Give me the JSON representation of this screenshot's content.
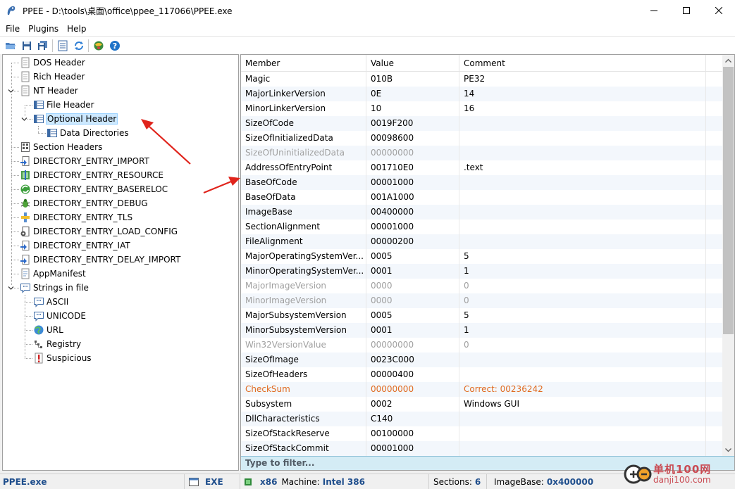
{
  "window": {
    "title": "PPEE - D:\\tools\\桌面\\office\\ppee_117066\\PPEE.exe"
  },
  "menu": [
    "File",
    "Plugins",
    "Help"
  ],
  "toolbar": [
    "open-icon",
    "save-icon",
    "save-all-icon",
    "properties-icon",
    "refresh-icon",
    "plugins-icon",
    "help-icon"
  ],
  "tree": [
    {
      "label": "DOS Header",
      "icon": "doc-icon",
      "level": 0,
      "selected": false
    },
    {
      "label": "Rich Header",
      "icon": "doc-icon",
      "level": 0,
      "selected": false
    },
    {
      "label": "NT Header",
      "icon": "doc-icon",
      "level": 0,
      "selected": false
    },
    {
      "label": "File Header",
      "icon": "grid-icon",
      "level": 1,
      "selected": false
    },
    {
      "label": "Optional Header",
      "icon": "grid-icon",
      "level": 1,
      "selected": true
    },
    {
      "label": "Data Directories",
      "icon": "grid-icon",
      "level": 2,
      "selected": false
    },
    {
      "label": "Section Headers",
      "icon": "sections-icon",
      "level": 0,
      "selected": false
    },
    {
      "label": "DIRECTORY_ENTRY_IMPORT",
      "icon": "import-icon",
      "level": 0,
      "selected": false
    },
    {
      "label": "DIRECTORY_ENTRY_RESOURCE",
      "icon": "resource-icon",
      "level": 0,
      "selected": false
    },
    {
      "label": "DIRECTORY_ENTRY_BASERELOC",
      "icon": "reloc-icon",
      "level": 0,
      "selected": false
    },
    {
      "label": "DIRECTORY_ENTRY_DEBUG",
      "icon": "bug-icon",
      "level": 0,
      "selected": false
    },
    {
      "label": "DIRECTORY_ENTRY_TLS",
      "icon": "tls-icon",
      "level": 0,
      "selected": false
    },
    {
      "label": "DIRECTORY_ENTRY_LOAD_CONFIG",
      "icon": "config-icon",
      "level": 0,
      "selected": false
    },
    {
      "label": "DIRECTORY_ENTRY_IAT",
      "icon": "import-icon",
      "level": 0,
      "selected": false
    },
    {
      "label": "DIRECTORY_ENTRY_DELAY_IMPORT",
      "icon": "import-icon",
      "level": 0,
      "selected": false
    },
    {
      "label": "AppManifest",
      "icon": "manifest-icon",
      "level": 0,
      "selected": false
    },
    {
      "label": "Strings in file",
      "icon": "strings-icon",
      "level": 0,
      "selected": false
    },
    {
      "label": "ASCII",
      "icon": "strings-icon",
      "level": 1,
      "selected": false
    },
    {
      "label": "UNICODE",
      "icon": "strings-icon",
      "level": 1,
      "selected": false
    },
    {
      "label": "URL",
      "icon": "globe-icon",
      "level": 1,
      "selected": false
    },
    {
      "label": "Registry",
      "icon": "registry-icon",
      "level": 1,
      "selected": false
    },
    {
      "label": "Suspicious",
      "icon": "warning-icon",
      "level": 1,
      "selected": false
    }
  ],
  "grid": {
    "columns": [
      "Member",
      "Value",
      "Comment"
    ],
    "rows": [
      {
        "member": "Magic",
        "value": "010B",
        "comment": "PE32",
        "state": "normal"
      },
      {
        "member": "MajorLinkerVersion",
        "value": "0E",
        "comment": "14",
        "state": "normal"
      },
      {
        "member": "MinorLinkerVersion",
        "value": "10",
        "comment": "16",
        "state": "normal"
      },
      {
        "member": "SizeOfCode",
        "value": "0019F200",
        "comment": "",
        "state": "normal"
      },
      {
        "member": "SizeOfInitializedData",
        "value": "00098600",
        "comment": "",
        "state": "normal"
      },
      {
        "member": "SizeOfUninitializedData",
        "value": "00000000",
        "comment": "",
        "state": "dim"
      },
      {
        "member": "AddressOfEntryPoint",
        "value": "001710E0",
        "comment": ".text",
        "state": "normal"
      },
      {
        "member": "BaseOfCode",
        "value": "00001000",
        "comment": "",
        "state": "normal"
      },
      {
        "member": "BaseOfData",
        "value": "001A1000",
        "comment": "",
        "state": "normal"
      },
      {
        "member": "ImageBase",
        "value": "00400000",
        "comment": "",
        "state": "normal"
      },
      {
        "member": "SectionAlignment",
        "value": "00001000",
        "comment": "",
        "state": "normal"
      },
      {
        "member": "FileAlignment",
        "value": "00000200",
        "comment": "",
        "state": "normal"
      },
      {
        "member": "MajorOperatingSystemVer...",
        "value": "0005",
        "comment": "5",
        "state": "normal"
      },
      {
        "member": "MinorOperatingSystemVer...",
        "value": "0001",
        "comment": "1",
        "state": "normal"
      },
      {
        "member": "MajorImageVersion",
        "value": "0000",
        "comment": "0",
        "state": "dim"
      },
      {
        "member": "MinorImageVersion",
        "value": "0000",
        "comment": "0",
        "state": "dim"
      },
      {
        "member": "MajorSubsystemVersion",
        "value": "0005",
        "comment": "5",
        "state": "normal"
      },
      {
        "member": "MinorSubsystemVersion",
        "value": "0001",
        "comment": "1",
        "state": "normal"
      },
      {
        "member": "Win32VersionValue",
        "value": "00000000",
        "comment": "0",
        "state": "dim"
      },
      {
        "member": "SizeOfImage",
        "value": "0023C000",
        "comment": "",
        "state": "normal"
      },
      {
        "member": "SizeOfHeaders",
        "value": "00000400",
        "comment": "",
        "state": "normal"
      },
      {
        "member": "CheckSum",
        "value": "00000000",
        "comment": "Correct: 00236242",
        "state": "warn"
      },
      {
        "member": "Subsystem",
        "value": "0002",
        "comment": "Windows GUI",
        "state": "normal"
      },
      {
        "member": "DllCharacteristics",
        "value": "C140",
        "comment": "",
        "state": "normal"
      },
      {
        "member": "SizeOfStackReserve",
        "value": "00100000",
        "comment": "",
        "state": "normal"
      },
      {
        "member": "SizeOfStackCommit",
        "value": "00001000",
        "comment": "",
        "state": "normal"
      }
    ],
    "filter_placeholder": "Type to filter..."
  },
  "status": {
    "file": "PPEE.exe",
    "type": "EXE",
    "arch": "x86",
    "machine_label": "Machine:",
    "machine_value": "Intel 386",
    "sections_label": "Sections:",
    "sections_value": "6",
    "imagebase_label": "ImageBase:",
    "imagebase_value": "0x400000"
  },
  "watermark": {
    "cn": "单机100网",
    "url": "danji100.com"
  },
  "colors": {
    "selection": "#cce8ff",
    "warn_text": "#e06a20",
    "dim_text": "#a0a0a0",
    "filter_bg": "#d4ecf5",
    "arrow": "#e0241c"
  }
}
